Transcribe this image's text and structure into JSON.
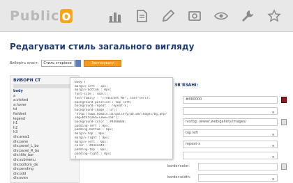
{
  "topbar": {
    "logo_text": "Public",
    "logo_badge": "o",
    "icons": [
      "chart-bars-icon",
      "document-icon",
      "pen-icon",
      "image-icon",
      "eye-icon",
      "wrench-icon",
      "star-icon"
    ]
  },
  "page": {
    "title": "Редагувати стиль загального вигляду"
  },
  "selector": {
    "label": "Виберіть власт:",
    "value": "Стиль сторінки",
    "button_label": "Застосувати"
  },
  "left_panel": {
    "header": "ВИБОРИ СТ",
    "items": [
      "body",
      "a",
      "a:visited",
      "a:hover",
      "td",
      "fieldset",
      "legend",
      "h1",
      "h2",
      "h3",
      "div.area1",
      "div.pane",
      "div.panel_L_bo",
      "div.panel_R_bo",
      "div.title_bar",
      "div.submenu",
      "div.bottom_de",
      "div.pending",
      "div.odd",
      "div.even"
    ]
  },
  "code_popup": {
    "lines": [
      "body {",
      "  margin-left : 3px;",
      "  margin-bottom : 0px;",
      "  font-size : small;",
      "  font-family : \"Trebuchet MS\", sans-serif;",
      "  background-position : top left;",
      "  background-repeat : repeat-x;",
      "  background-image : url(",
      "  \"http://www.domain.ua/gallery/db.wm/images/bg.php?",
      "  img=bt4fd2&h=13&w=150\");",
      "  background-color : #4400000;",
      "  padding-left : 0px;",
      "  padding-bottom : 0px;",
      "  margin-top : 0px;",
      "  margin-right : 0px;",
      "  margin-left : 0px;",
      "  color : #4444444;",
      "  padding-top : 0px;",
      "  padding-right : 0px;",
      "}"
    ]
  },
  "properties": {
    "header": "ЗВ'ЯЗАНІ:",
    "rows": [
      {
        "label": "",
        "value": "#880000"
      },
      {
        "label": "",
        "value": ""
      },
      {
        "label": "",
        "value": ""
      },
      {
        "label": "",
        "value": ""
      },
      {
        "label": "",
        "value": "top left"
      },
      {
        "label": "",
        "value": "repeat-x"
      },
      {
        "label": "",
        "value": ""
      },
      {
        "label": "border-color:",
        "value": ""
      },
      {
        "label": "border-width:",
        "value": ""
      }
    ],
    "image_field_placeholder": "ivorbg: /www/.web/gallery/images/"
  }
}
